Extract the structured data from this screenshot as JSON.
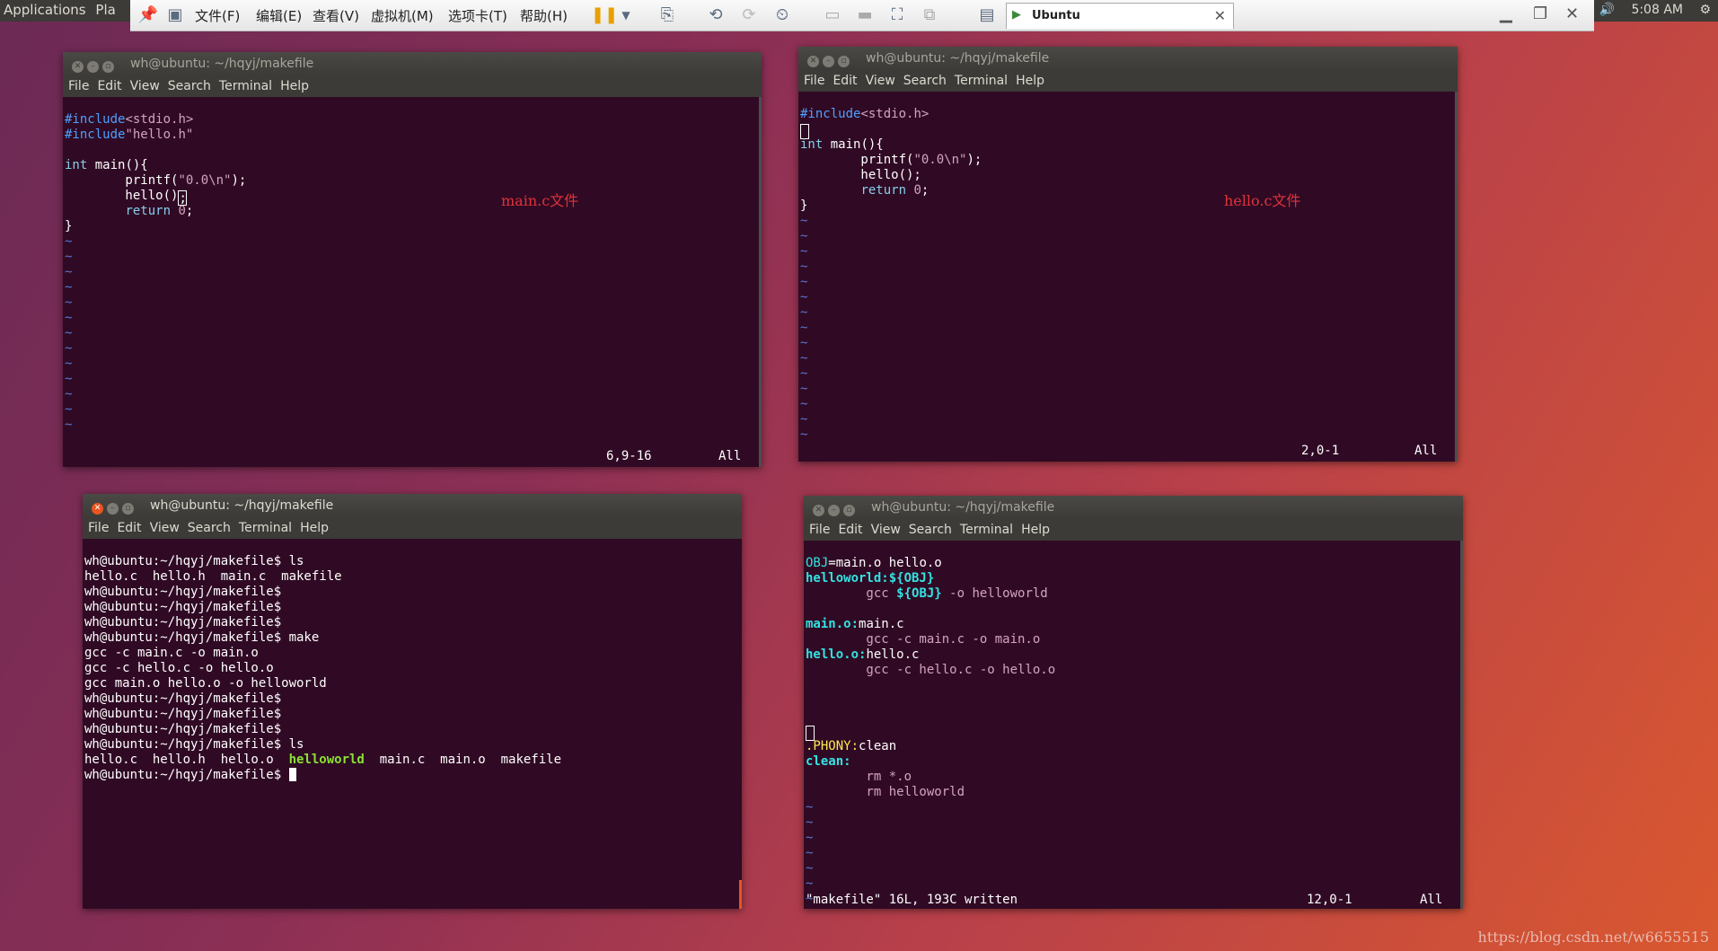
{
  "topbar": {
    "apps_label": "Applications",
    "places_label": "Pla",
    "clock": "5:08 AM",
    "volume_icon": "speaker-icon",
    "settings_icon": "gear-icon"
  },
  "vm": {
    "menus": [
      "文件(F)",
      "编辑(E)",
      "查看(V)",
      "虚拟机(M)",
      "选项卡(T)",
      "帮助(H)"
    ],
    "tab_label": "Ubuntu"
  },
  "terminals": {
    "main_c": {
      "title": "wh@ubuntu: ~/hqyj/makefile",
      "annotation": "main.c文件",
      "position": "6,9-16",
      "scope": "All"
    },
    "hello_c": {
      "title": "wh@ubuntu: ~/hqyj/makefile",
      "annotation": "hello.c文件",
      "position": "2,0-1",
      "scope": "All"
    },
    "shell": {
      "title": "wh@ubuntu: ~/hqyj/makefile",
      "lines": [
        "wh@ubuntu:~/hqyj/makefile$ ls",
        "hello.c  hello.h  main.c  makefile",
        "wh@ubuntu:~/hqyj/makefile$",
        "wh@ubuntu:~/hqyj/makefile$",
        "wh@ubuntu:~/hqyj/makefile$",
        "wh@ubuntu:~/hqyj/makefile$ make",
        "gcc -c main.c -o main.o",
        "gcc -c hello.c -o hello.o",
        "gcc main.o hello.o -o helloworld",
        "wh@ubuntu:~/hqyj/makefile$",
        "wh@ubuntu:~/hqyj/makefile$",
        "wh@ubuntu:~/hqyj/makefile$",
        "wh@ubuntu:~/hqyj/makefile$ ls"
      ],
      "ls_before": "hello.c  hello.h  hello.o  ",
      "ls_exec": "helloworld",
      "ls_after": "  main.c  main.o  makefile",
      "prompt": "wh@ubuntu:~/hqyj/makefile$ "
    },
    "makefile": {
      "title": "wh@ubuntu: ~/hqyj/makefile",
      "status_msg": "\"makefile\" 16L, 193C written",
      "position": "12,0-1",
      "scope": "All"
    }
  },
  "menu_items": [
    "File",
    "Edit",
    "View",
    "Search",
    "Terminal",
    "Help"
  ],
  "watermark": "https://blog.csdn.net/w6655515"
}
